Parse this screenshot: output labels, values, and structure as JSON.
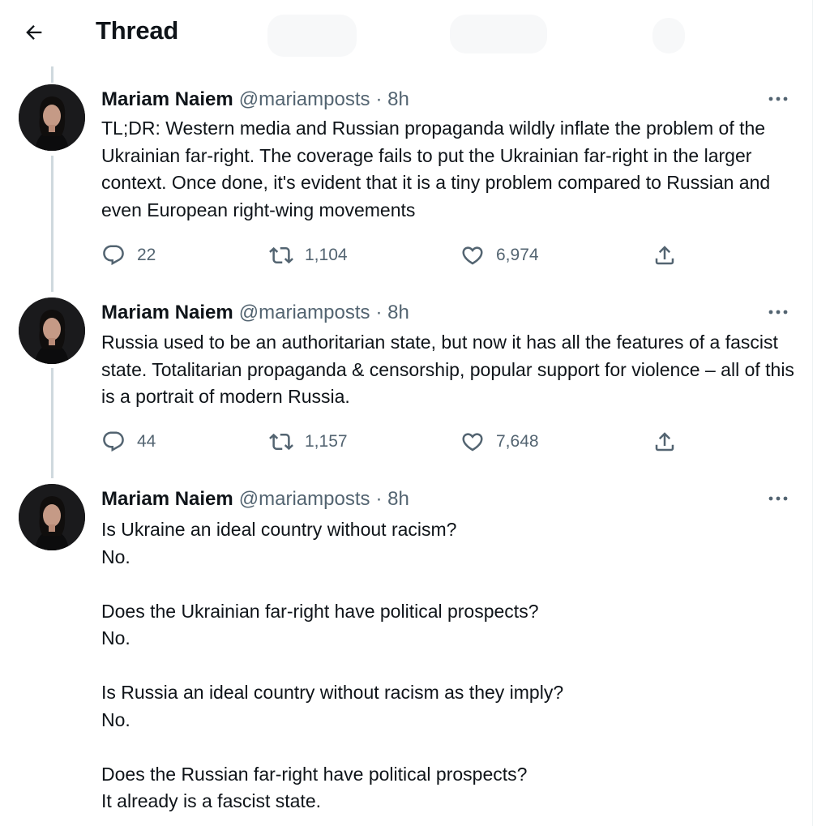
{
  "header": {
    "title": "Thread"
  },
  "icons": {
    "back": "arrow-left-icon",
    "more": "more-horizontal-icon",
    "reply": "reply-icon",
    "retweet": "retweet-icon",
    "like": "heart-icon",
    "share": "share-icon"
  },
  "tweets": [
    {
      "author": "Mariam Naiem",
      "handle": "@mariamposts",
      "time": "· 8h",
      "text": "TL;DR: Western media and Russian propaganda wildly inflate the problem of the Ukrainian far-right. The coverage fails to put the Ukrainian far-right in the larger context. Once done, it's evident that it is a tiny problem compared to Russian and even European right-wing movements",
      "replies": "22",
      "retweets": "1,104",
      "likes": "6,974"
    },
    {
      "author": "Mariam Naiem",
      "handle": "@mariamposts",
      "time": "· 8h",
      "text": "Russia used to be an authoritarian state, but now it has all the features of a fascist state. Totalitarian propaganda & censorship, popular support for violence – all of this is a portrait of modern Russia.",
      "replies": "44",
      "retweets": "1,157",
      "likes": "7,648"
    },
    {
      "author": "Mariam Naiem",
      "handle": "@mariamposts",
      "time": "· 8h",
      "text": "Is Ukraine an ideal country without racism?\nNo.\n\nDoes the Ukrainian far-right have political prospects?\nNo.\n\nIs Russia an ideal country without racism as they imply?\nNo.\n\nDoes the Russian far-right have political prospects?\nIt already is a fascist state."
    }
  ]
}
